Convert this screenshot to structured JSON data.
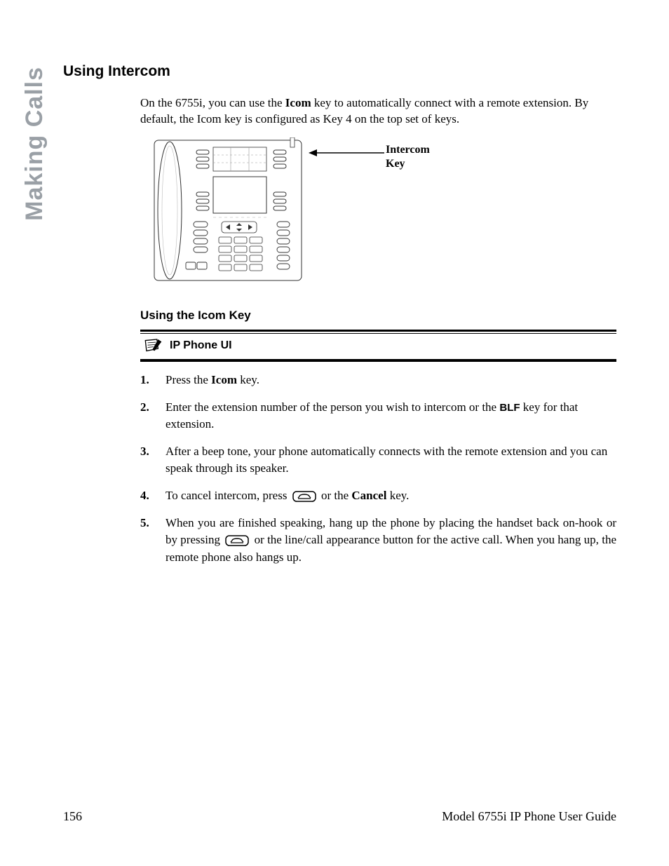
{
  "side_tab": "Making Calls",
  "heading": "Using Intercom",
  "intro_part1": "On the 6755i, you can use the ",
  "intro_bold1": "Icom",
  "intro_part2": " key to automatically connect with a remote extension. By default, the Icom key is configured as Key 4 on the top set of keys.",
  "callout_line1": "Intercom",
  "callout_line2": "Key",
  "sub_heading": "Using the Icom Key",
  "ip_phone_ui_label": "IP Phone UI",
  "steps": {
    "s1_num": "1.",
    "s1_a": "Press the ",
    "s1_bold": "Icom",
    "s1_b": " key.",
    "s2_num": "2.",
    "s2_a": "Enter the extension number of the person you wish to intercom or the ",
    "s2_blf": "BLF",
    "s2_b": " key for that extension.",
    "s3_num": "3.",
    "s3_a": "After a beep tone, your phone automatically connects with the remote extension and you can speak through its speaker.",
    "s4_num": "4.",
    "s4_a": "To cancel intercom, press ",
    "s4_b": " or the ",
    "s4_bold": "Cancel",
    "s4_c": " key.",
    "s5_num": "5.",
    "s5_a": "When you are finished speaking, hang up the phone by placing the handset back on-hook or by pressing ",
    "s5_b": " or the line/call appearance button for the active call. When you hang up, the remote phone also hangs up."
  },
  "footer_page": "156",
  "footer_title": "Model 6755i IP Phone User Guide"
}
